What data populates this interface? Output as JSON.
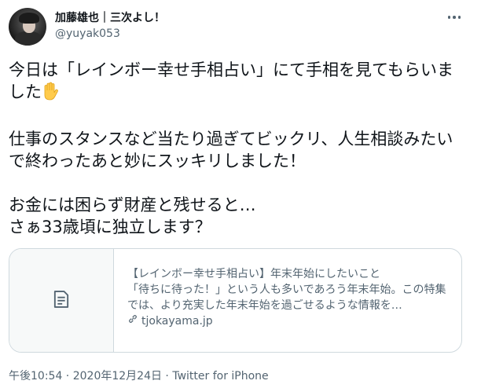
{
  "user": {
    "display_name": "加藤雄也｜三次よし！",
    "handle": "@yuyak053"
  },
  "tweet": {
    "paragraph1": "今日は「レインボー幸せ手相占い」にて手相を見てもらいました",
    "paragraph2": "仕事のスタンスなど当たり過ぎてビックリ、人生相談みたいで終わったあと妙にスッキリしました！",
    "paragraph3": "お金には困らず財産と残せると…\nさぁ33歳頃に独立します？",
    "emoji": "raised-hand-emoji"
  },
  "card": {
    "title": "【レインボー幸せ手相占い】年末年始にしたいこと",
    "description": "「待ちに待った！」という人も多いであろう年末年始。この特集では、より充実した年末年始を過ごせるような情報を…",
    "domain": "tjokayama.jp",
    "thumb_icon": "article-icon",
    "domain_icon": "link-icon"
  },
  "meta": {
    "time": "午後10:54",
    "separator1": " · ",
    "date": "2020年12月24日",
    "separator2": " · ",
    "source": "Twitter for iPhone"
  },
  "icons": {
    "more": "more-options-icon"
  },
  "colors": {
    "text": "#0f1419",
    "secondary": "#536471",
    "border": "#cfd9de"
  }
}
